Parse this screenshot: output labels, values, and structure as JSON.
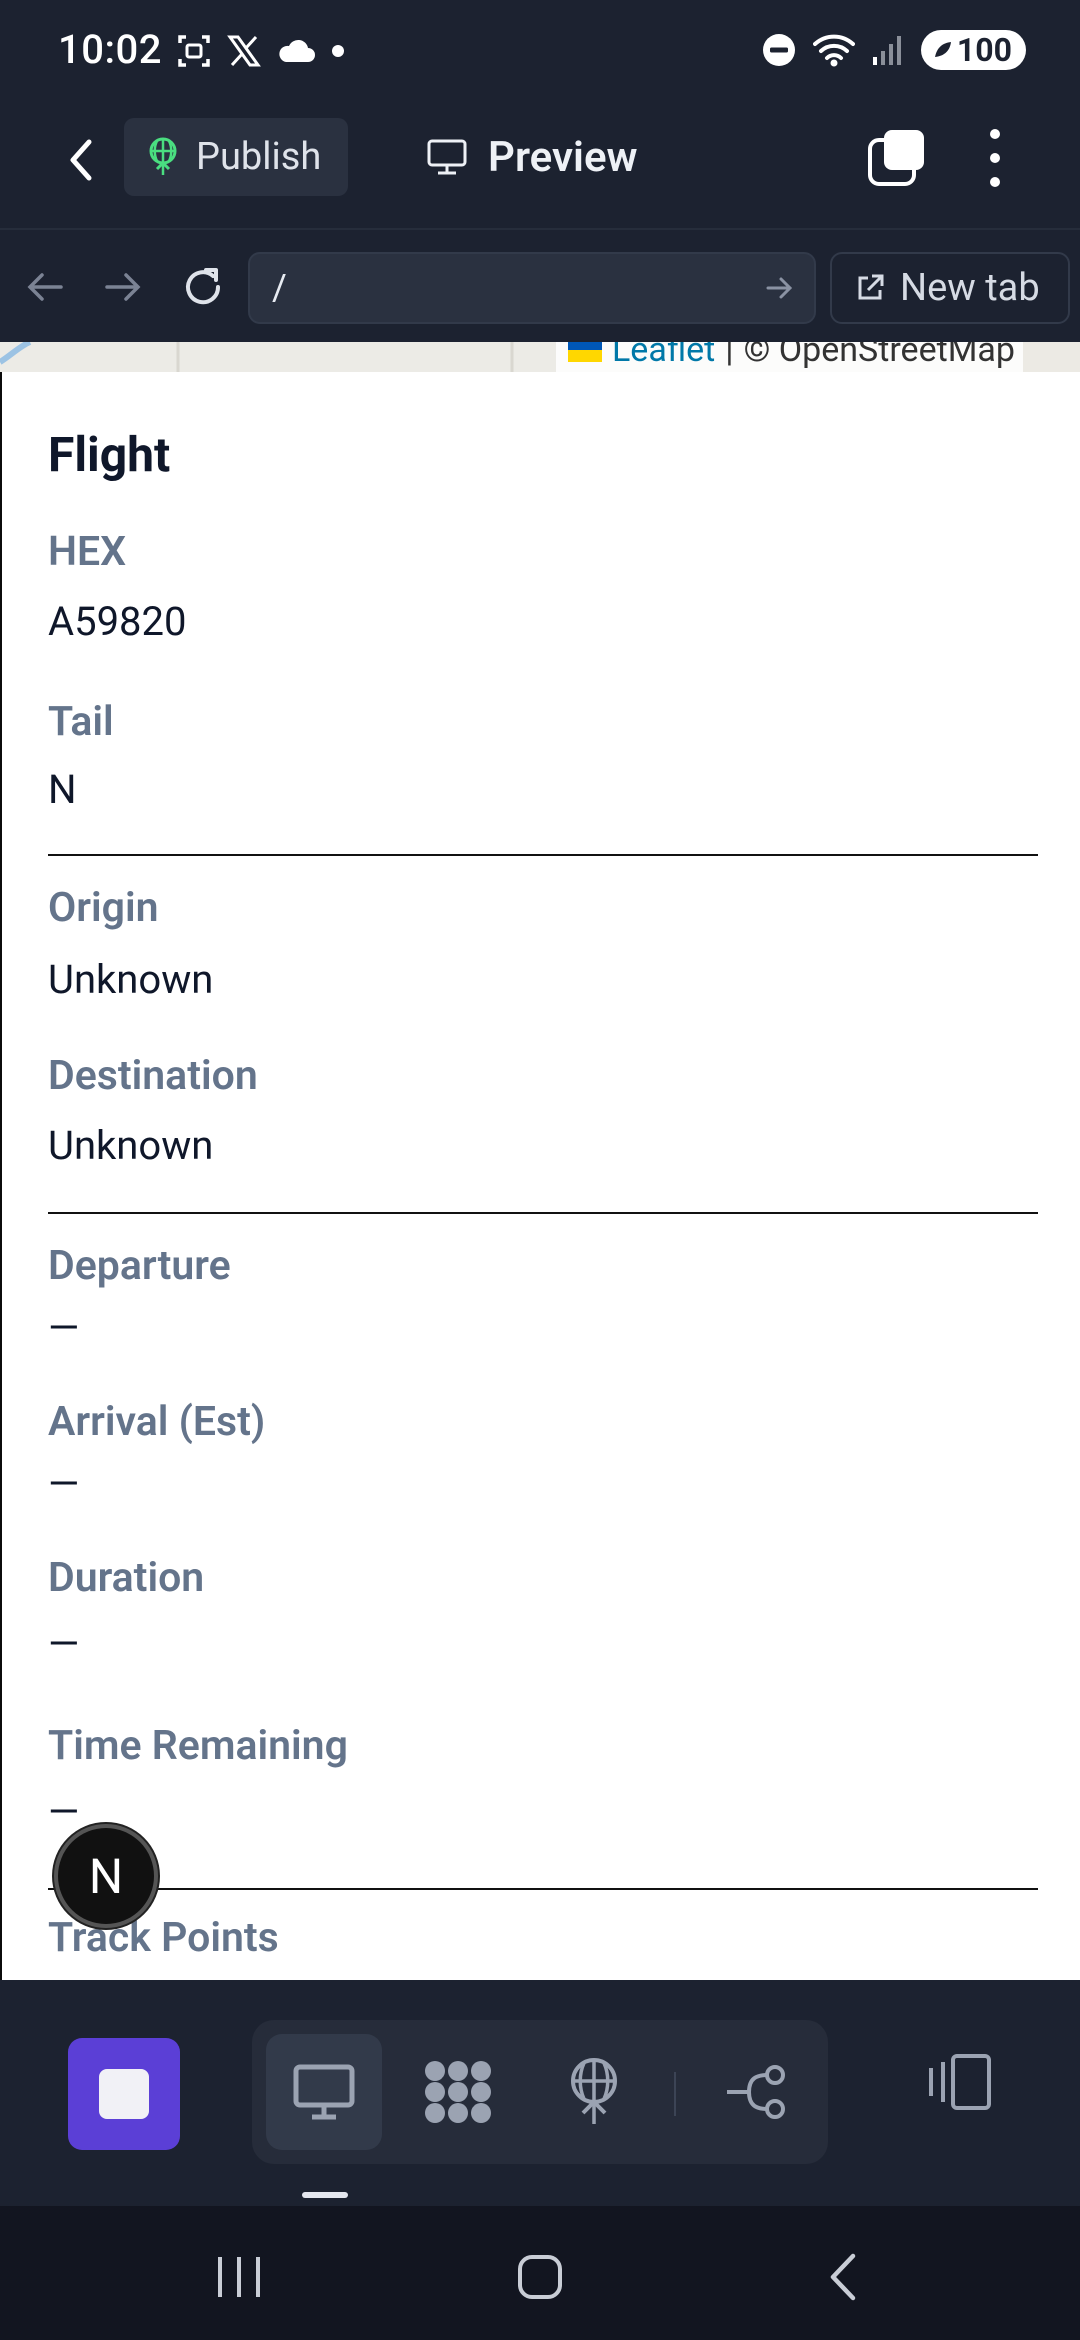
{
  "status_bar": {
    "time": "10:02",
    "battery": "100",
    "icons_left": [
      "screenshot-icon",
      "x-icon",
      "cloud-icon",
      "dot-icon"
    ],
    "icons_right": [
      "dnd-icon",
      "wifi-icon",
      "signal-icon",
      "battery-icon"
    ]
  },
  "toolbar": {
    "publish_label": "Publish",
    "preview_label": "Preview"
  },
  "url_bar": {
    "value": "/",
    "new_tab_label": "New tab"
  },
  "map": {
    "attribution_link": "Leaflet",
    "attribution_sep": "|",
    "attribution_text": "© OpenStreetMap"
  },
  "panel": {
    "title": "Flight",
    "fields": {
      "hex": {
        "label": "HEX",
        "value": "A59820"
      },
      "tail": {
        "label": "Tail",
        "value": "N"
      },
      "origin": {
        "label": "Origin",
        "value": "Unknown"
      },
      "destination": {
        "label": "Destination",
        "value": "Unknown"
      },
      "departure": {
        "label": "Departure",
        "value": "—"
      },
      "arrival": {
        "label": "Arrival (Est)",
        "value": "—"
      },
      "duration": {
        "label": "Duration",
        "value": "—"
      },
      "time_remaining": {
        "label": "Time Remaining",
        "value": "—"
      },
      "track_points": {
        "label": "Track Points"
      }
    }
  },
  "badge": {
    "letter": "N"
  },
  "bottom_tools": [
    "desktop-icon",
    "apps-icon",
    "publish-icon",
    "workflow-icon"
  ],
  "colors": {
    "chrome_bg": "#1c2230",
    "accent": "#5b3fd6",
    "label": "#64748b",
    "text": "#0f172a"
  }
}
